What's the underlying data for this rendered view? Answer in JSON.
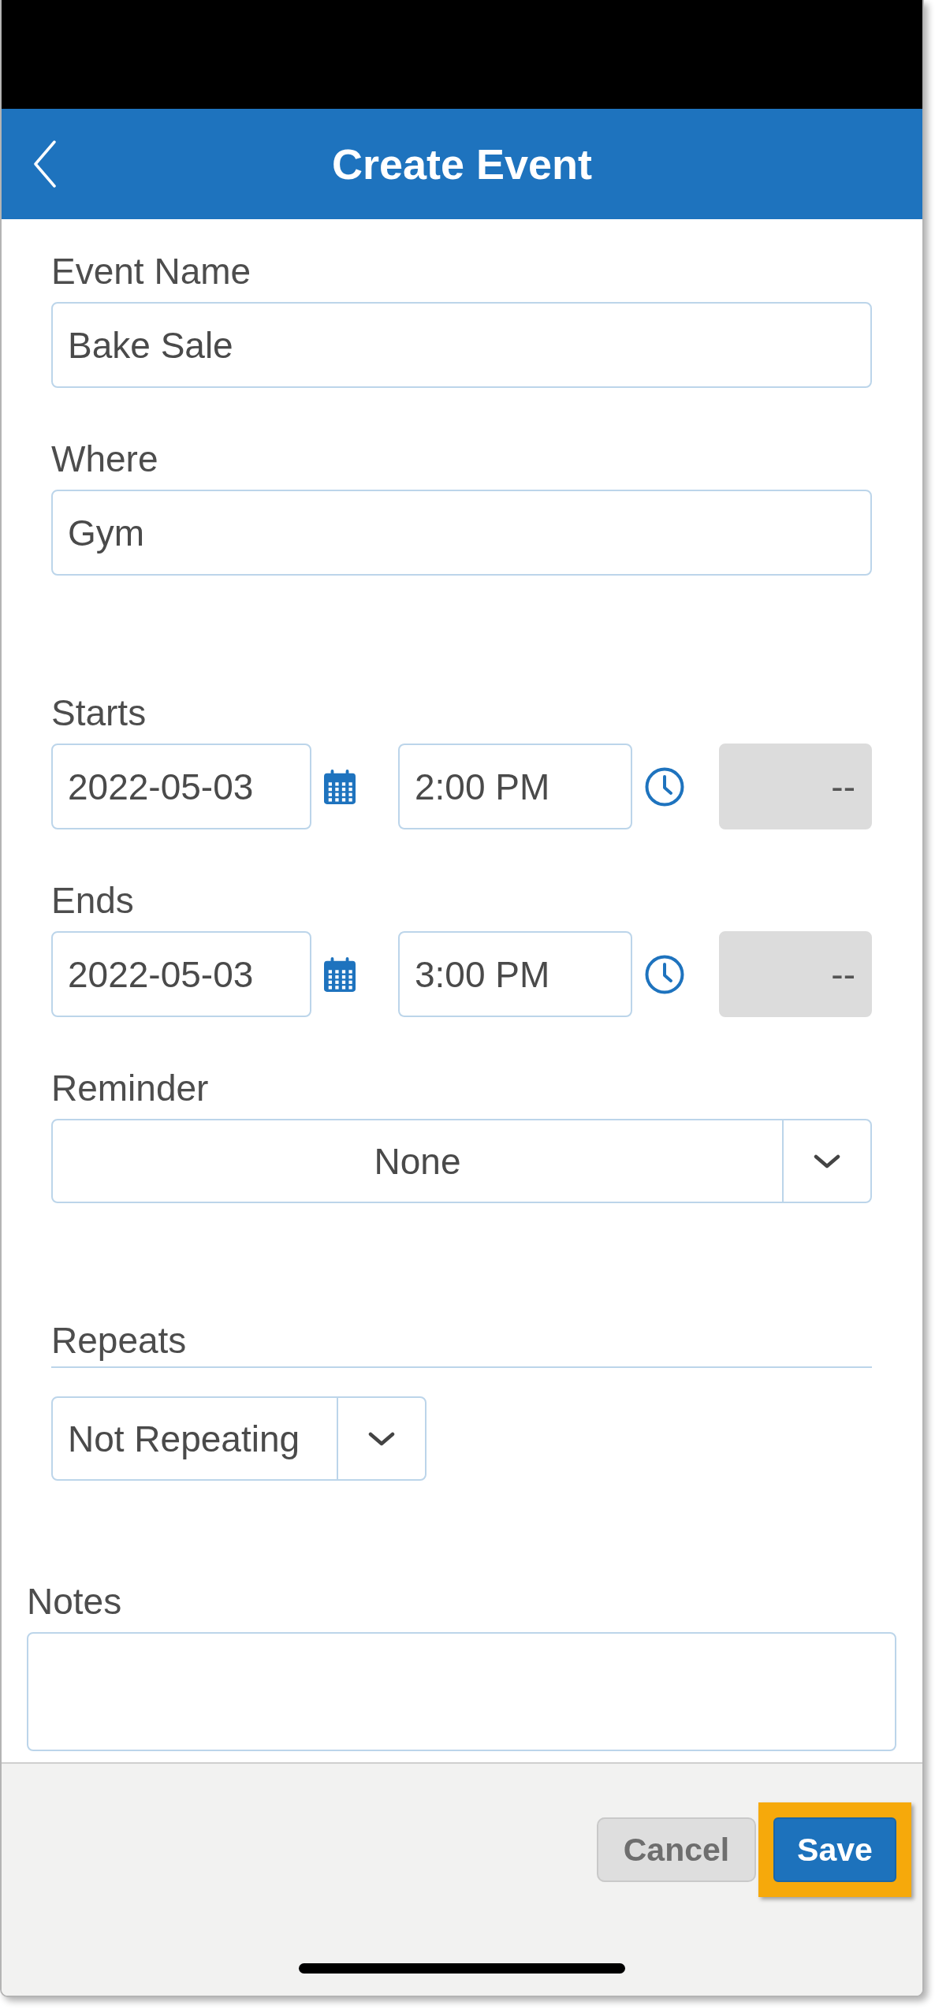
{
  "header": {
    "title": "Create Event"
  },
  "sections": [
    {
      "fields": [
        {
          "kind": "text",
          "label": "Event Name",
          "value": "Bake Sale"
        },
        {
          "kind": "text",
          "label": "Where",
          "value": "Gym"
        }
      ]
    },
    {
      "fields": [
        {
          "kind": "datetime",
          "label": "Starts",
          "date": "2022-05-03",
          "time": "2:00 PM",
          "extra": {
            "value": "--",
            "disabled": true
          }
        },
        {
          "kind": "datetime",
          "label": "Ends",
          "date": "2022-05-03",
          "time": "3:00 PM",
          "extra": {
            "value": "--",
            "disabled": true
          }
        },
        {
          "kind": "select",
          "label": "Reminder",
          "value": "None"
        }
      ]
    },
    {
      "fields": [
        {
          "kind": "compact_select",
          "label": "Repeats",
          "value": "Not Repeating"
        }
      ]
    }
  ],
  "notes": {
    "label": "Notes"
  },
  "footer": {
    "buttons": [
      {
        "kind": "secondary",
        "label": "Cancel",
        "highlighted": false
      },
      {
        "kind": "primary",
        "label": "Save",
        "highlighted": true
      }
    ]
  }
}
